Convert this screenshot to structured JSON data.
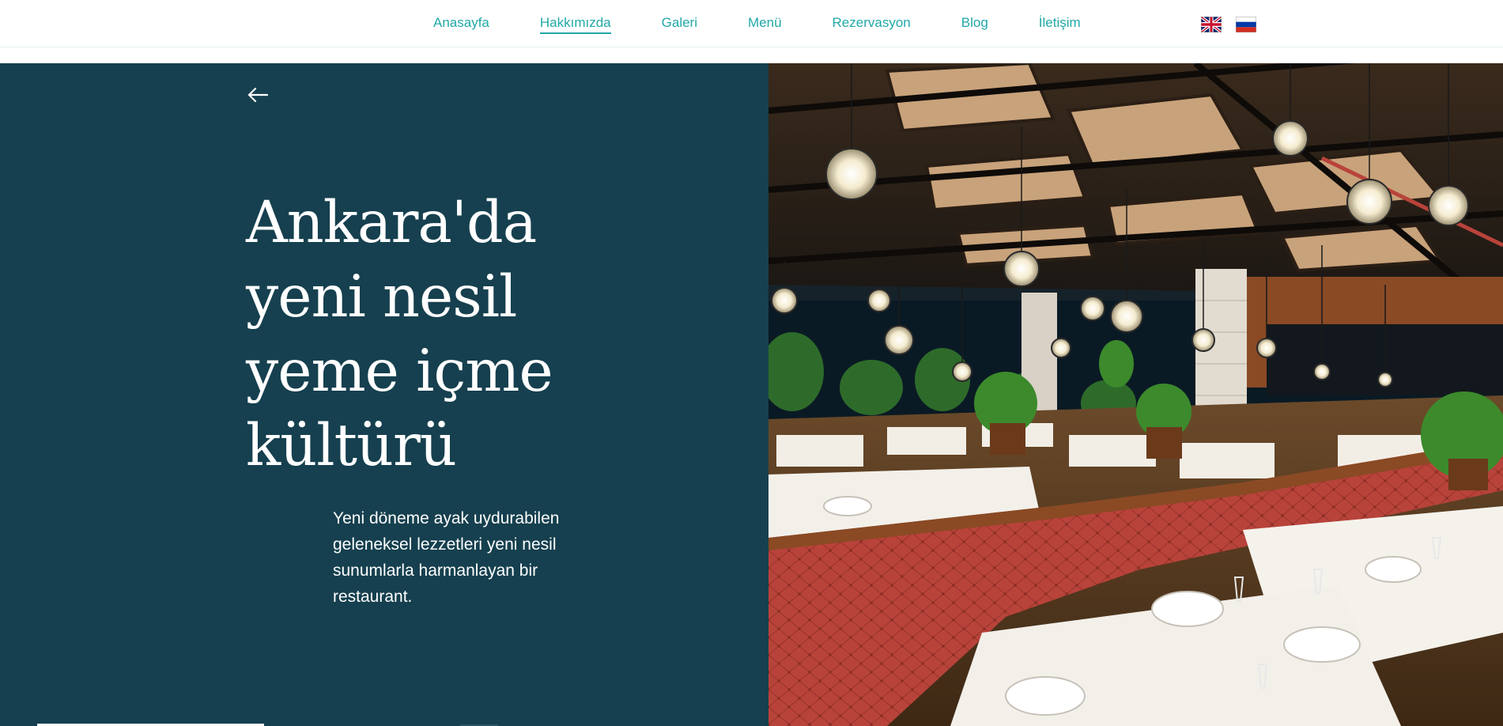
{
  "nav": {
    "items": [
      {
        "label": "Anasayfa"
      },
      {
        "label": "Hakkımızda",
        "active": true
      },
      {
        "label": "Galeri"
      },
      {
        "label": "Menü"
      },
      {
        "label": "Rezervasyon"
      },
      {
        "label": "Blog"
      },
      {
        "label": "İletişim"
      }
    ],
    "languages": [
      {
        "icon": "uk-flag-icon"
      },
      {
        "icon": "russia-flag-icon"
      }
    ]
  },
  "hero": {
    "back_icon": "arrow-left-icon",
    "headline": "Ankara'da yeni nesil yeme içme kültürü",
    "description": "Yeni döneme ayak uydurabilen geleneksel lezzetleri yeni nesil sunumlarla harmanlayan bir restaurant.",
    "image_icon": "restaurant-interior-photo"
  },
  "colors": {
    "accent": "#21a8a8",
    "hero_background": "#16404f",
    "text_light": "#ffffff",
    "banquette_red": "#b8433a"
  }
}
